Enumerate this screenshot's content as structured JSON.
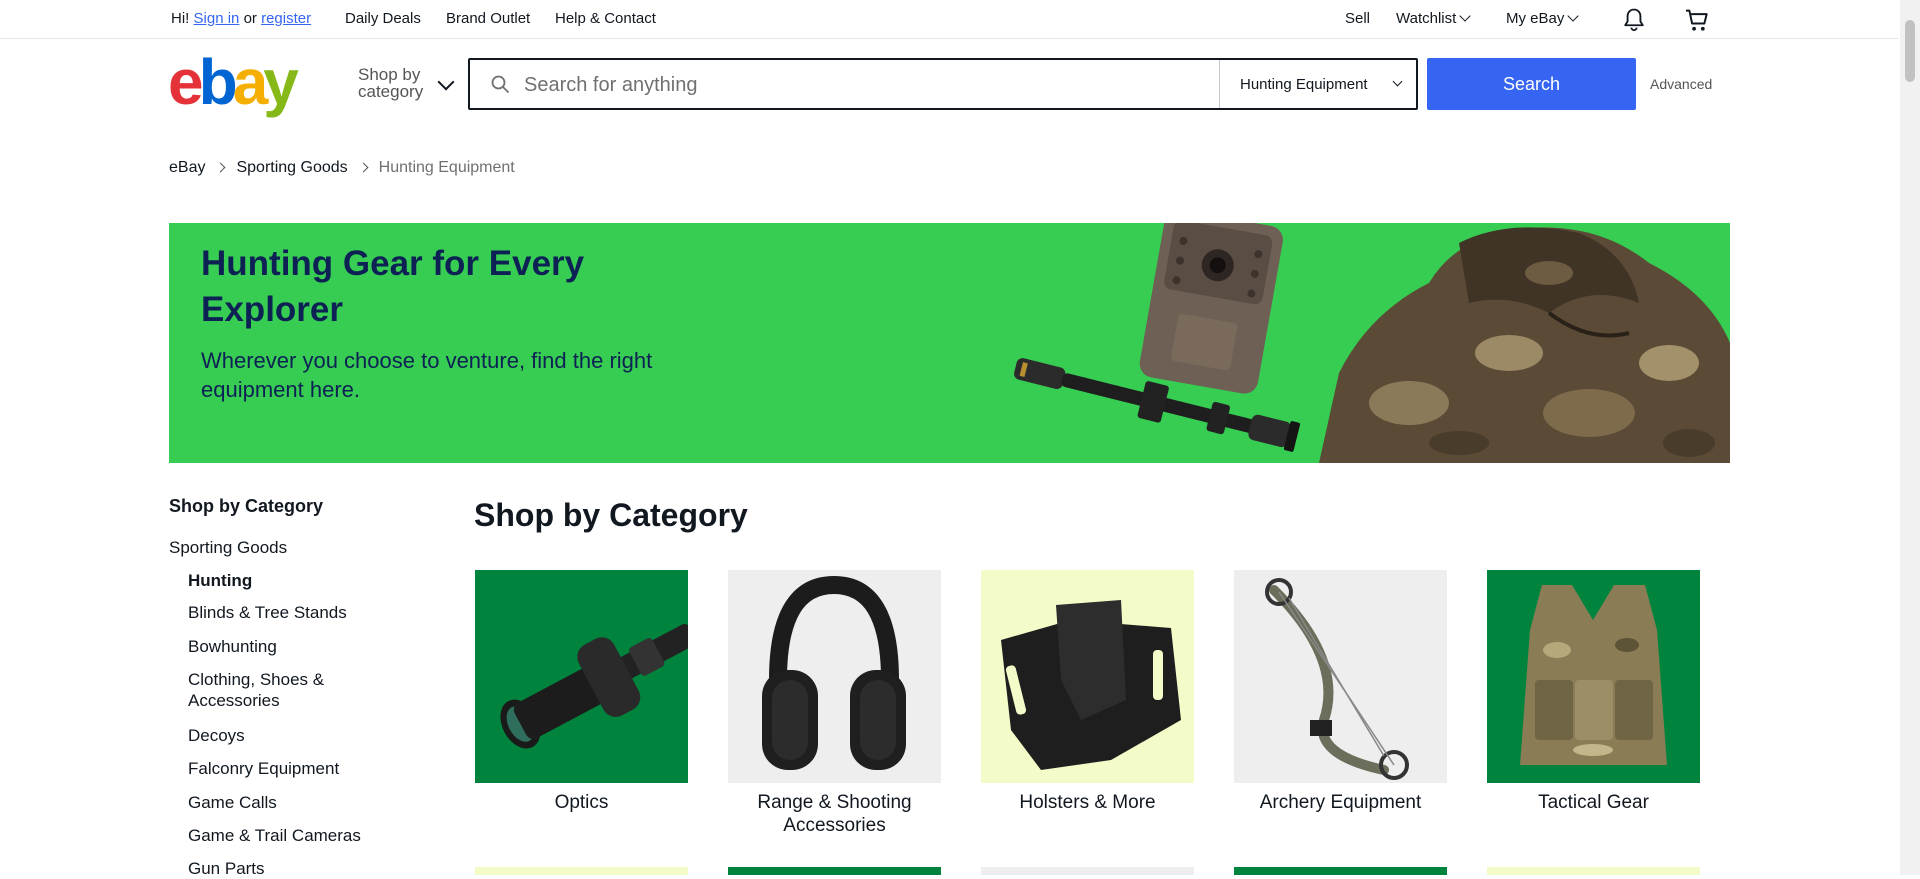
{
  "topnav": {
    "greeting_prefix": "Hi!",
    "sign_in": "Sign in",
    "or": "or",
    "register": "register",
    "daily_deals": "Daily Deals",
    "brand_outlet": "Brand Outlet",
    "help_contact": "Help & Contact",
    "sell": "Sell",
    "watchlist": "Watchlist",
    "my_ebay": "My eBay",
    "icons": [
      "bell-icon",
      "cart-icon"
    ]
  },
  "header": {
    "logo_letters": [
      "e",
      "b",
      "a",
      "y"
    ],
    "logo_colors": [
      "#e53238",
      "#0064d2",
      "#f5af02",
      "#86b817"
    ],
    "shop_by_line1": "Shop by",
    "shop_by_line2": "category",
    "search_placeholder": "Search for anything",
    "search_value": "",
    "category_selected": "Hunting Equipment",
    "search_button": "Search",
    "advanced": "Advanced"
  },
  "breadcrumb": {
    "items": [
      "eBay",
      "Sporting Goods",
      "Hunting Equipment"
    ]
  },
  "hero": {
    "title": "Hunting Gear for Every Explorer",
    "subtitle": "Wherever you choose to venture, find the right equipment here.",
    "background": "#36cd52"
  },
  "leftnav": {
    "heading": "Shop by Category",
    "parent": "Sporting Goods",
    "current": "Hunting",
    "items": [
      "Blinds & Tree Stands",
      "Bowhunting",
      "Clothing, Shoes & Accessories",
      "Decoys",
      "Falconry Equipment",
      "Game Calls",
      "Game & Trail Cameras",
      "Gun Parts"
    ]
  },
  "main": {
    "section_title": "Shop by Category",
    "tiles": [
      {
        "label": "Optics",
        "bg": "#00843d"
      },
      {
        "label": "Range & Shooting Accessories",
        "bg": "#eeeeee"
      },
      {
        "label": "Holsters & More",
        "bg": "#f3fbc9"
      },
      {
        "label": "Archery Equipment",
        "bg": "#eeeeee"
      },
      {
        "label": "Tactical Gear",
        "bg": "#00843d"
      }
    ],
    "next_row_bgs": [
      "#f3fbc9",
      "#00843d",
      "#eeeeee",
      "#00843d",
      "#f3fbc9"
    ]
  }
}
